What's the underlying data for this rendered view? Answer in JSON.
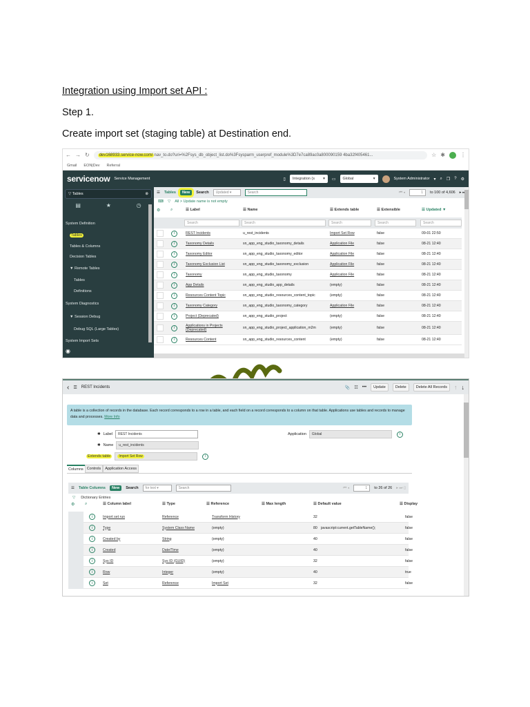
{
  "doc": {
    "heading": "Integration using Import set API :",
    "step": "Step 1.",
    "instruction": "Create import set (staging table) at Destination end."
  },
  "shot1": {
    "url_highlight": "dev168933.service-now.com/",
    "url_rest": "nav_to.do?uri=%2Fsys_db_object_list.do%3Fsysparm_userpref_module%3D7e7ca89ac0a800090159 4ba32f405461...",
    "bookmarks": [
      "Gmail",
      "EON|Dev",
      "Referral"
    ],
    "brand": "servicenow",
    "product": "Service Management",
    "app_scope": "Integration (s",
    "update_set": "Global",
    "user": "System Administrator",
    "filter_text": "Tables",
    "sidebar": [
      "System Definition",
      "Tables",
      "Tables & Columns",
      "Decision Tables",
      "▼ Remote Tables",
      "Tables",
      "Definitions",
      "System Diagnostics",
      "▼ Session Debug",
      "Debug SQL (Large Tables)",
      "System Import Sets"
    ],
    "list_title": "Tables",
    "new_label": "New",
    "search_label": "Search",
    "search_field": "Updated",
    "search_placeholder": "Search",
    "page": "1",
    "page_range": "to 100 of 4,606",
    "breadcrumb": "All > Update name is not empty",
    "columns": [
      "Label",
      "Name",
      "Extends table",
      "Extensible",
      "Updated ▼"
    ],
    "col_search": "Search",
    "rows": [
      [
        "REST Incidents",
        "u_rest_incidents",
        "Import Set Row",
        "false",
        "09-01 22:50"
      ],
      [
        "Taxonomy Details",
        "sn_app_eng_studio_taxonomy_details",
        "Application File",
        "false",
        "08-21 12:40"
      ],
      [
        "Taxonomy Editor",
        "sn_app_eng_studio_taxonomy_editor",
        "Application File",
        "false",
        "08-21 12:40"
      ],
      [
        "Taxonomy Exclusion List",
        "sn_app_eng_studio_taxonomy_exclusion",
        "Application File",
        "false",
        "08-21 12:40"
      ],
      [
        "Taxonomy",
        "sn_app_eng_studio_taxonomy",
        "Application File",
        "false",
        "08-21 12:40"
      ],
      [
        "App Details",
        "sn_app_eng_studio_app_details",
        "(empty)",
        "false",
        "08-21 12:40"
      ],
      [
        "Resources Content Topic",
        "sn_app_eng_studio_resources_content_topic",
        "(empty)",
        "false",
        "08-21 12:40"
      ],
      [
        "Taxonomy Category",
        "sn_app_eng_studio_taxonomy_category",
        "Application File",
        "false",
        "08-21 12:40"
      ],
      [
        "Project (Deprecated)",
        "sn_app_eng_studio_project",
        "(empty)",
        "false",
        "08-21 12:40"
      ],
      [
        "Applications in Projects (Deprecated)",
        "sn_app_eng_studio_project_application_m2m",
        "(empty)",
        "false",
        "08-21 12:40"
      ],
      [
        "Resources Content",
        "sn_app_eng_studio_resources_content",
        "(empty)",
        "false",
        "08-21 12:40"
      ]
    ]
  },
  "shot2": {
    "title": "REST Incidents",
    "buttons": [
      "Update",
      "Delete",
      "Delete All Records"
    ],
    "info": "A table is a collection of records in the database. Each record corresponds to a row in a table, and each field on a record corresponds to a column on that table. Applications use tables and records to manage data and processes.",
    "more_info": "More Info",
    "label_label": "Label",
    "label_value": "REST Incidents",
    "name_label": "Name",
    "name_value": "u_rest_incidents",
    "extends_label": "Extends table",
    "extends_value": "Import Set Row",
    "app_label": "Application",
    "app_value": "Global",
    "tabs": [
      "Columns",
      "Controls",
      "Application Access"
    ],
    "list_title": "Table Columns",
    "new_label": "New",
    "search_label": "Search",
    "search_field": "for text",
    "search_placeholder": "Search",
    "page": "1",
    "page_range": "to 26 of 26",
    "breadcrumb": "Dictionary Entries",
    "columns": [
      "Column label",
      "Type",
      "Reference",
      "Max length",
      "Default value",
      "Display"
    ],
    "rows": [
      [
        "Import set run",
        "Reference",
        "Transform History",
        "32",
        "",
        "false"
      ],
      [
        "Type",
        "System Class Name",
        "(empty)",
        "80",
        "javascript:current.getTableName();",
        "false"
      ],
      [
        "Created by",
        "String",
        "(empty)",
        "40",
        "",
        "false"
      ],
      [
        "Created",
        "Date/Time",
        "(empty)",
        "40",
        "",
        "false"
      ],
      [
        "Sys ID",
        "Sys ID (GUID)",
        "(empty)",
        "32",
        "",
        "false"
      ],
      [
        "Row",
        "Integer",
        "(empty)",
        "40",
        "",
        "true"
      ],
      [
        "Set",
        "Reference",
        "Import Set",
        "32",
        "",
        "false"
      ]
    ]
  },
  "colors": {
    "sn_dark": "#293e40",
    "sn_green": "#278062",
    "highlight": "#f2f23a",
    "info_bg": "#b4dde6"
  }
}
